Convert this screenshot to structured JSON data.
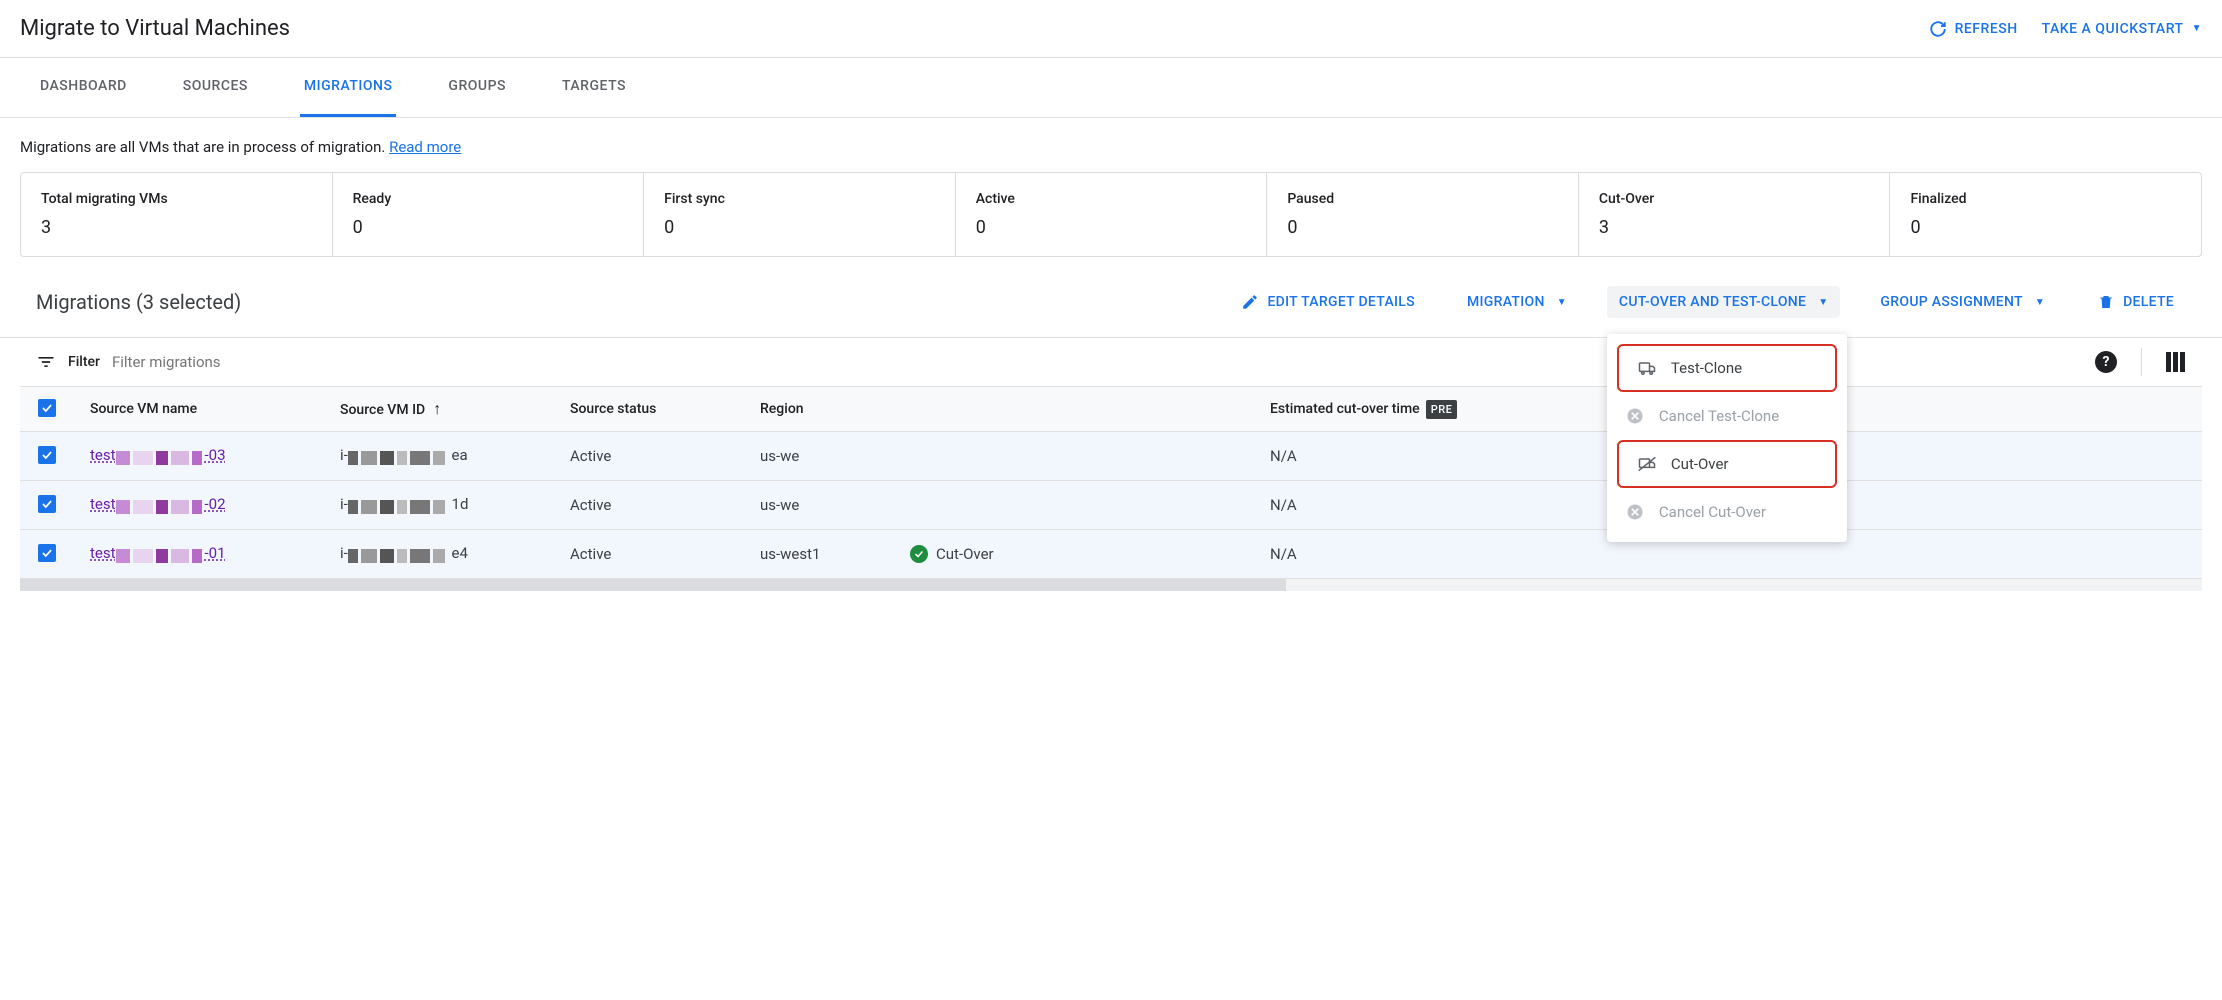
{
  "header": {
    "title": "Migrate to Virtual Machines",
    "refresh": "REFRESH",
    "quickstart": "TAKE A QUICKSTART"
  },
  "tabs": {
    "dashboard": "DASHBOARD",
    "sources": "SOURCES",
    "migrations": "MIGRATIONS",
    "groups": "GROUPS",
    "targets": "TARGETS",
    "active": "migrations"
  },
  "description": {
    "text": "Migrations are all VMs that are in process of migration.  ",
    "link": "Read more"
  },
  "stats": [
    {
      "label": "Total migrating VMs",
      "value": "3"
    },
    {
      "label": "Ready",
      "value": "0"
    },
    {
      "label": "First sync",
      "value": "0"
    },
    {
      "label": "Active",
      "value": "0"
    },
    {
      "label": "Paused",
      "value": "0"
    },
    {
      "label": "Cut-Over",
      "value": "3"
    },
    {
      "label": "Finalized",
      "value": "0"
    }
  ],
  "toolbar": {
    "title": "Migrations (3 selected)",
    "edit": "EDIT TARGET DETAILS",
    "migration": "MIGRATION",
    "cutover": "CUT-OVER AND TEST-CLONE",
    "group": "GROUP ASSIGNMENT",
    "delete": "DELETE"
  },
  "dropdown": {
    "test_clone": "Test-Clone",
    "cancel_test_clone": "Cancel Test-Clone",
    "cut_over": "Cut-Over",
    "cancel_cut_over": "Cancel Cut-Over"
  },
  "filter": {
    "label": "Filter",
    "placeholder": "Filter migrations"
  },
  "columns": {
    "name": "Source VM name",
    "id": "Source VM ID",
    "status": "Source status",
    "region": "Region",
    "migration_status": "",
    "est_time": "Estimated cut-over time",
    "badge": "PRE"
  },
  "rows": [
    {
      "name_prefix": "test",
      "name_suffix": "-03",
      "id_prefix": "i-",
      "id_suffix": "ea",
      "status": "Active",
      "region": "us-we",
      "mig_status": "",
      "est": "N/A"
    },
    {
      "name_prefix": "test",
      "name_suffix": "-02",
      "id_prefix": "i-",
      "id_suffix": "1d",
      "status": "Active",
      "region": "us-we",
      "mig_status": "",
      "est": "N/A"
    },
    {
      "name_prefix": "test",
      "name_suffix": "-01",
      "id_prefix": "i-",
      "id_suffix": "e4",
      "status": "Active",
      "region": "us-west1",
      "mig_status": "Cut-Over",
      "est": "N/A"
    }
  ]
}
